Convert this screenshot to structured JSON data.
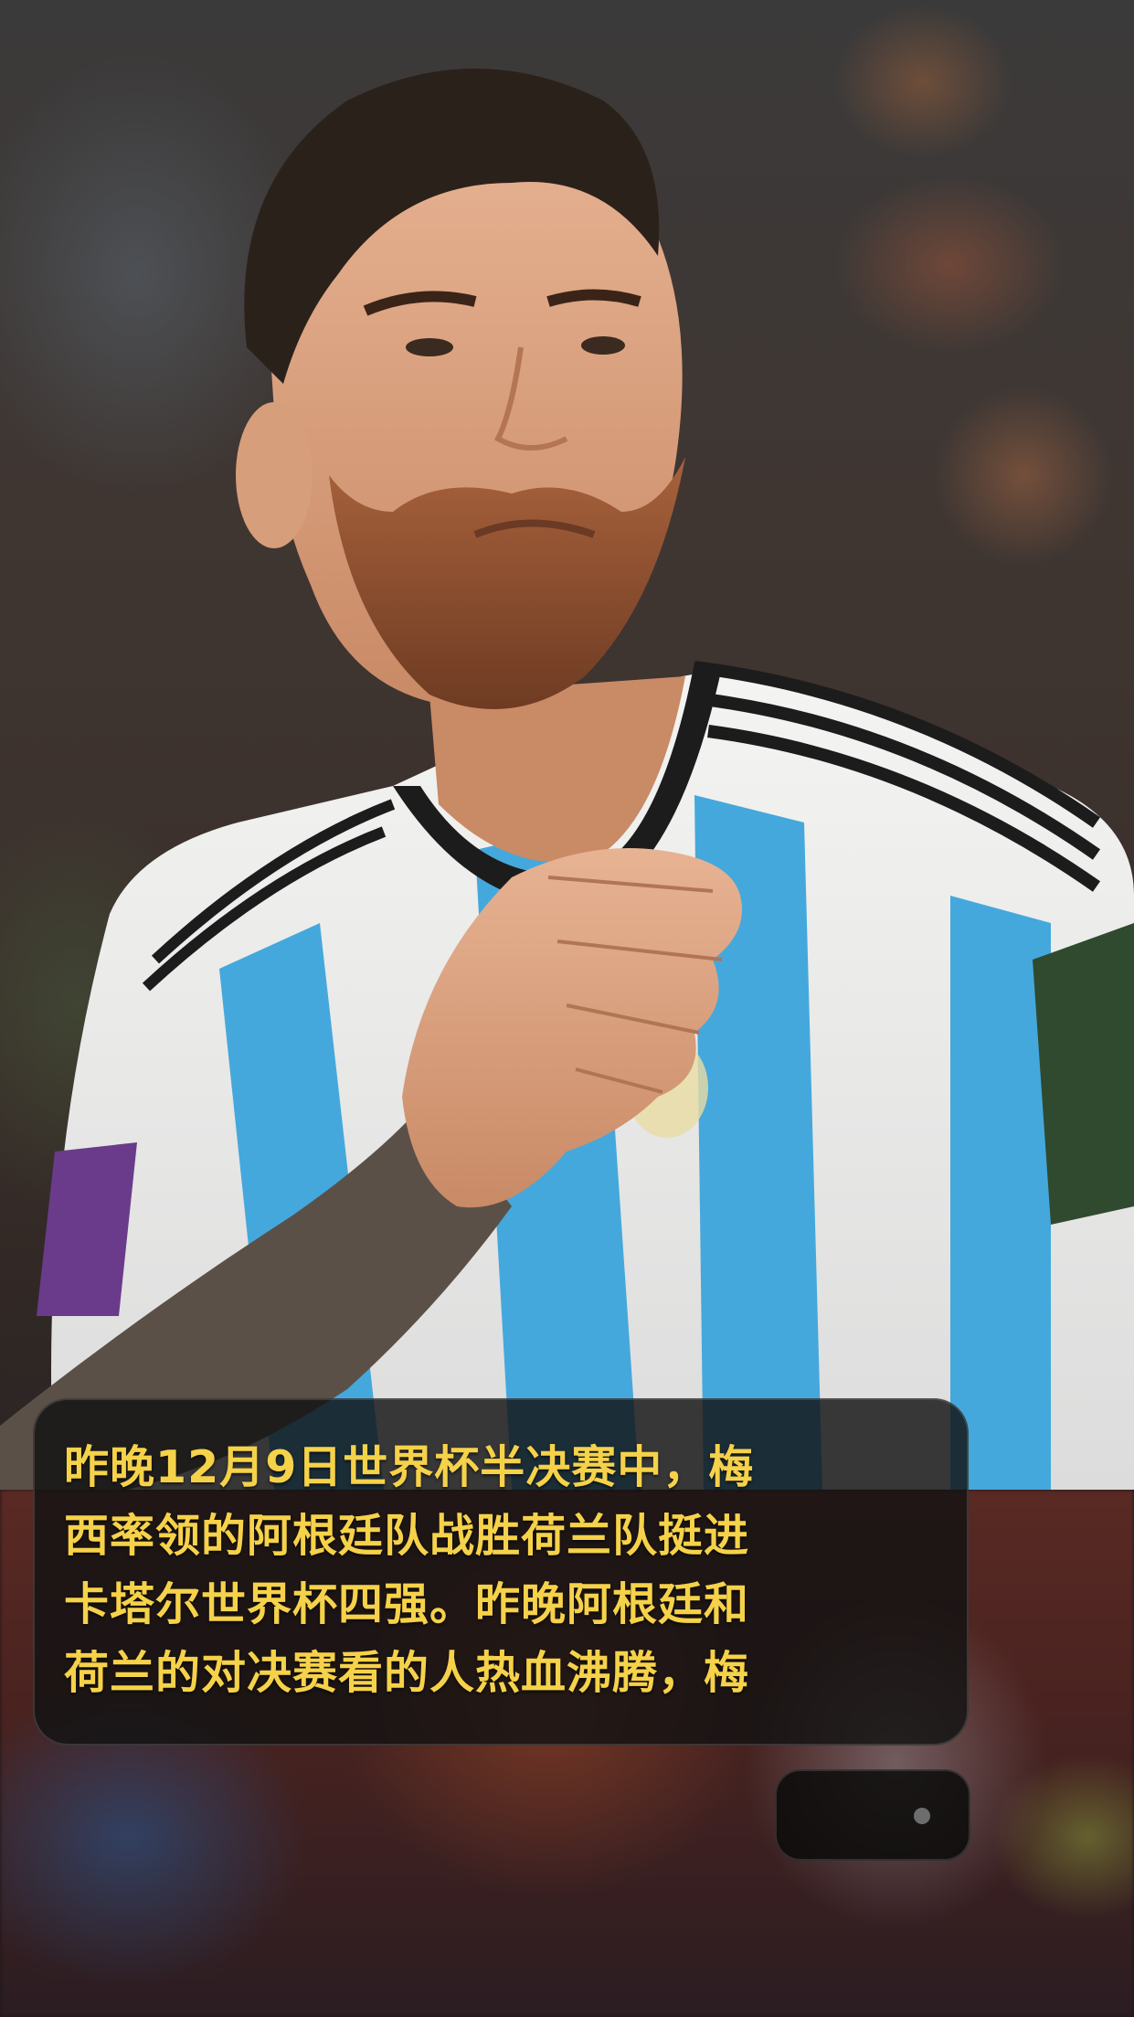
{
  "photo": {
    "subject": "soccer-player-hand-on-chest",
    "jersey_colors": [
      "#ffffff",
      "#45a8dc",
      "#1c1c1c"
    ],
    "background_tone": "#3a302c"
  },
  "caption": {
    "lines": [
      "昨晚12月9日世界杯半决赛中，梅",
      "西率领的阿根廷队战胜荷兰队挺进",
      "卡塔尔世界杯四强。昨晚阿根廷和",
      "荷兰的对决赛看的人热血沸腾，梅"
    ],
    "text_color": "#f6d24a",
    "card_color": "#121212"
  },
  "pill": {
    "indicator_icon": "dot-icon"
  }
}
